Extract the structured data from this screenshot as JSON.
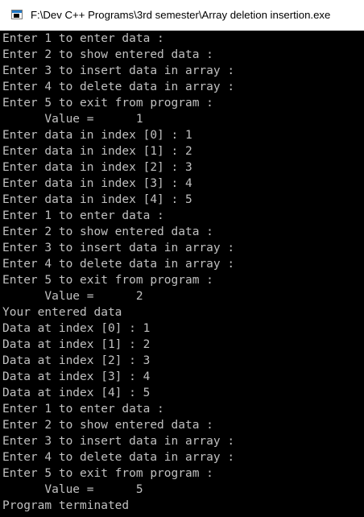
{
  "window": {
    "title": "F:\\Dev C++ Programs\\3rd semester\\Array deletion insertion.exe",
    "icon": "console-app-icon"
  },
  "console": {
    "lines": [
      "Enter 1 to enter data :",
      "Enter 2 to show entered data :",
      "Enter 3 to insert data in array :",
      "Enter 4 to delete data in array :",
      "Enter 5 to exit from program :",
      "      Value =      1",
      "Enter data in index [0] : 1",
      "Enter data in index [1] : 2",
      "Enter data in index [2] : 3",
      "Enter data in index [3] : 4",
      "Enter data in index [4] : 5",
      "Enter 1 to enter data :",
      "Enter 2 to show entered data :",
      "Enter 3 to insert data in array :",
      "Enter 4 to delete data in array :",
      "Enter 5 to exit from program :",
      "      Value =      2",
      "Your entered data",
      "Data at index [0] : 1",
      "Data at index [1] : 2",
      "Data at index [2] : 3",
      "Data at index [3] : 4",
      "Data at index [4] : 5",
      "Enter 1 to enter data :",
      "Enter 2 to show entered data :",
      "Enter 3 to insert data in array :",
      "Enter 4 to delete data in array :",
      "Enter 5 to exit from program :",
      "      Value =      5",
      "Program terminated"
    ]
  },
  "colors": {
    "console_bg": "#000000",
    "console_text": "#c0c0c0",
    "titlebar_bg": "#ffffff",
    "title_text": "#000000"
  }
}
